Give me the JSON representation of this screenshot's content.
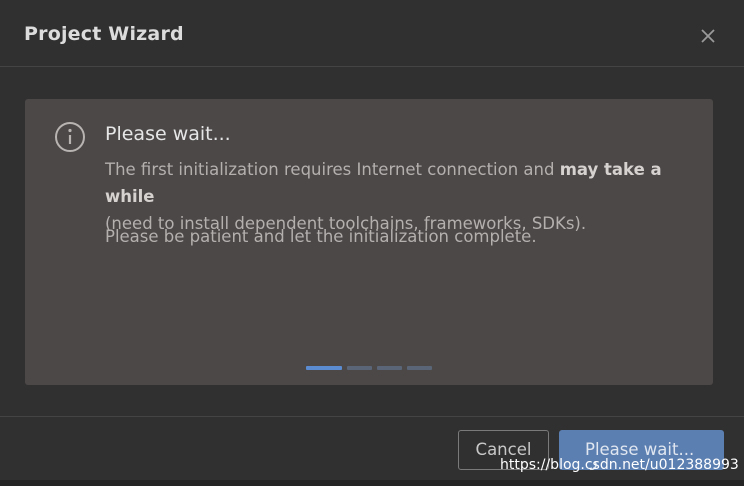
{
  "dialog": {
    "title": "Project Wizard",
    "close_icon": "close-icon"
  },
  "panel": {
    "icon": "info-icon",
    "heading": "Please wait...",
    "text_part1": "The first initialization requires Internet connection and ",
    "text_bold": "may take a while",
    "text_part2": "(need to install dependent toolchains, frameworks, SDKs).",
    "paragraph2": "Please be patient and let the initialization complete.",
    "progress": {
      "segments": 4,
      "active_segment": 1
    }
  },
  "footer": {
    "cancel_label": "Cancel",
    "primary_label": "Please wait...",
    "spinner_icon": "spinner-icon"
  },
  "watermark": "https://blog.csdn.net/u012388993",
  "colors": {
    "background": "#303030",
    "panel": "#4c4848",
    "accent": "#5c7fb1",
    "progress_active": "#5b8bd0",
    "progress_inactive": "#5a6577"
  }
}
